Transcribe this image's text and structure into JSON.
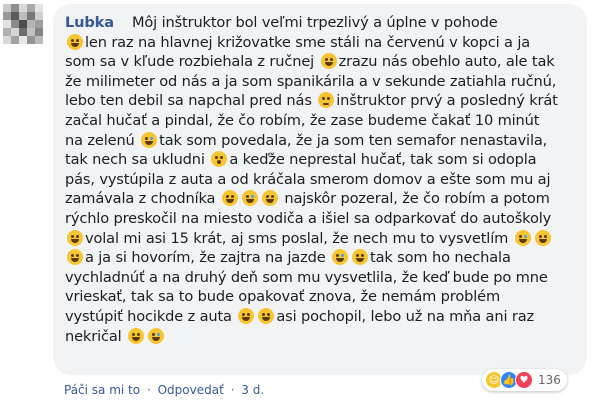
{
  "comment": {
    "author": "Lubka",
    "lines": [
      "Môj inštruktor bol veľmi trpezlivý a úplne v pohode",
      "len raz na hlavnej križovatke sme stáli na červenú v kopci a ja",
      "som sa v kľude rozbiehala z ručnej",
      "zrazu nás obehlo auto, ale tak",
      "že milimeter od nás a ja som spanikárila a v sekunde zatiahla ručnú,",
      "lebo ten debil sa napchal pred nás",
      "inštruktor prvý a posledný krát",
      "začal hučať a pindal, že čo robím, že zase budeme čakať 10 minút",
      "na zelenú",
      "tak som povedala, že ja som ten semafor nenastavila,",
      "tak nech sa ukludni",
      "a keďže neprestal hučať, tak som si odopla",
      "pás, vystúpila z auta a od kráčala smerom domov a ešte som mu aj",
      "zamávala z chodníka",
      "najskôr pozeral, že čo robím a potom",
      "rýchlo preskočil na miesto vodiča a išiel sa odparkovať do autoškoly",
      "volal mi asi 15 krát, aj sms poslal, že nech mu to vysvetlím",
      "a ja si hovorím, že zajtra na jazde",
      "tak som ho nechala",
      "vychladnúť a na druhý deň som mu vysvetlila, že keď bude po mne",
      "vrieskať, tak sa to bude opakovať znova, že nemám problém",
      "vystúpiť hocikde z auta",
      "asi pochopil, lebo už na mňa ani raz",
      "nekričal"
    ]
  },
  "actions": {
    "like": "Páči sa mi to",
    "dot1": "·",
    "reply": "Odpovedať",
    "dot2": "·",
    "time": "3 d."
  },
  "reactions": {
    "count": "136",
    "types": [
      "haha-icon",
      "like-icon",
      "love-icon"
    ]
  },
  "colors": {
    "author": "#385898",
    "bubble": "#f2f3f5",
    "meta": "#65676b"
  }
}
